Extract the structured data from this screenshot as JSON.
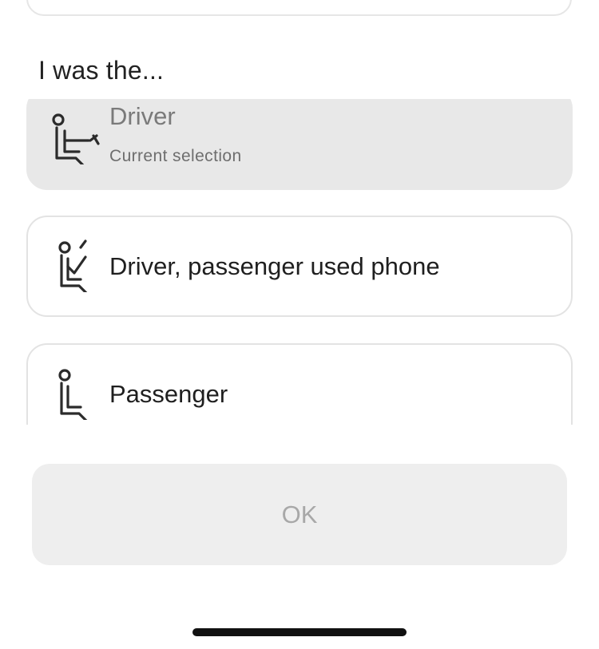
{
  "section": {
    "title": "I was the..."
  },
  "options": [
    {
      "label": "Driver",
      "sublabel": "Current selection",
      "icon": "driver-seat-icon",
      "selected": true
    },
    {
      "label": "Driver, passenger used phone",
      "icon": "driver-passenger-phone-icon",
      "selected": false
    },
    {
      "label": "Passenger",
      "icon": "passenger-seat-icon",
      "selected": false
    }
  ],
  "ok_button": {
    "label": "OK",
    "enabled": false
  },
  "colors": {
    "selected_background": "#e8e8e8",
    "card_border": "#e3e3e3",
    "button_background": "#eeeeee",
    "button_text_disabled": "#a8a8a8"
  }
}
